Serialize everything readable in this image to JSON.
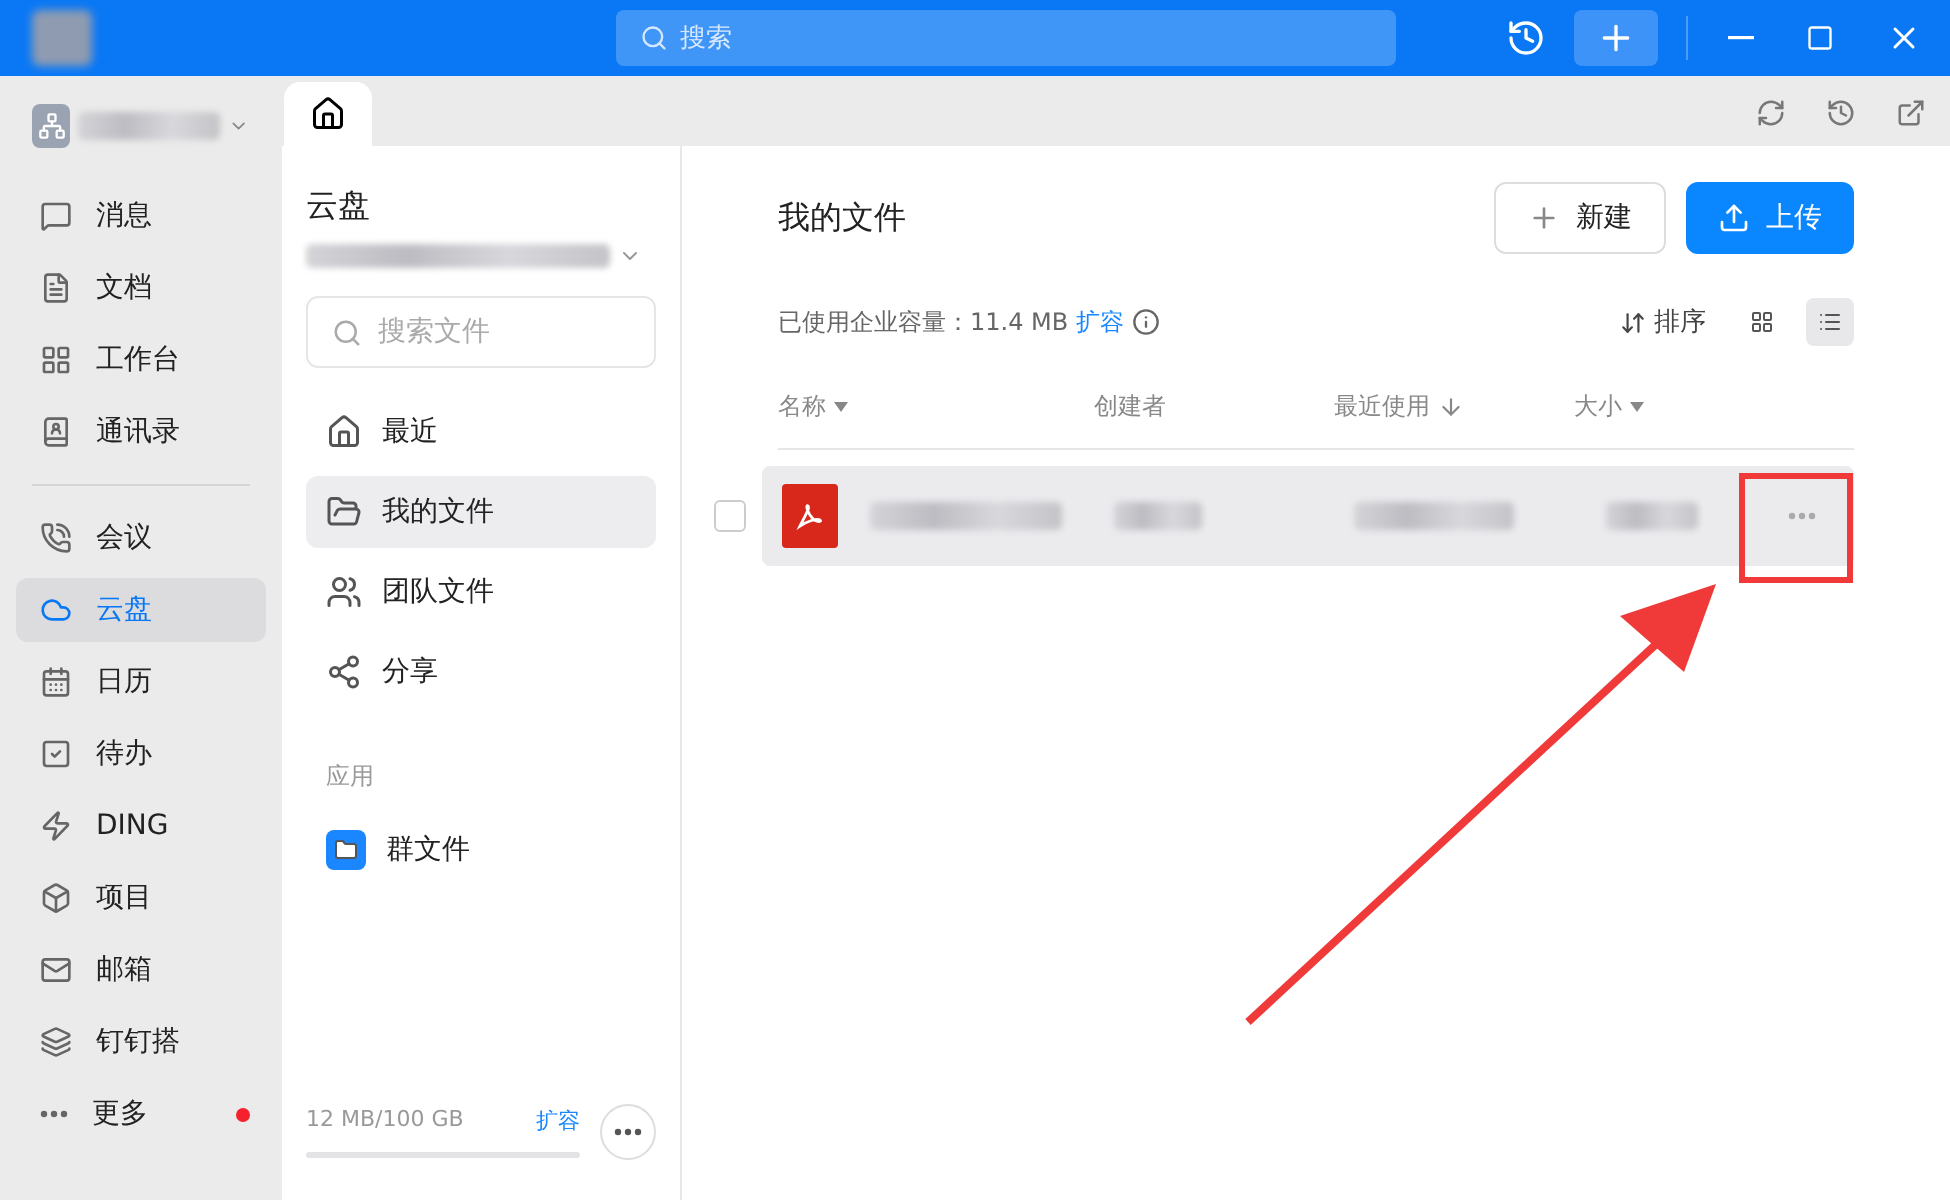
{
  "topbar": {
    "search_placeholder": "搜索"
  },
  "nav": {
    "items": [
      {
        "label": "消息",
        "selected": false,
        "badge": false
      },
      {
        "label": "文档",
        "selected": false,
        "badge": false
      },
      {
        "label": "工作台",
        "selected": false,
        "badge": false
      },
      {
        "label": "通讯录",
        "selected": false,
        "badge": false
      },
      {
        "label": "会议",
        "selected": false,
        "badge": false
      },
      {
        "label": "云盘",
        "selected": true,
        "badge": false
      },
      {
        "label": "日历",
        "selected": false,
        "badge": false
      },
      {
        "label": "待办",
        "selected": false,
        "badge": false
      },
      {
        "label": "DING",
        "selected": false,
        "badge": false
      },
      {
        "label": "项目",
        "selected": false,
        "badge": false
      },
      {
        "label": "邮箱",
        "selected": false,
        "badge": false
      },
      {
        "label": "钉钉搭",
        "selected": false,
        "badge": false
      },
      {
        "label": "更多",
        "selected": false,
        "badge": true
      }
    ]
  },
  "drive": {
    "title": "云盘",
    "search_placeholder": "搜索文件",
    "items": [
      {
        "label": "最近",
        "selected": false
      },
      {
        "label": "我的文件",
        "selected": true
      },
      {
        "label": "团队文件",
        "selected": false
      },
      {
        "label": "分享",
        "selected": false
      }
    ],
    "apps_heading": "应用",
    "apps": [
      {
        "label": "群文件"
      }
    ],
    "storage": {
      "text": "12 MB/100 GB",
      "link": "扩容"
    }
  },
  "main": {
    "title": "我的文件",
    "new_button": "新建",
    "upload_button": "上传",
    "usage_label": "已使用企业容量：11.4 MB",
    "usage_link": "扩容",
    "sort_label": "排序",
    "views": [
      {
        "kind": "grid",
        "selected": false
      },
      {
        "kind": "list",
        "selected": true
      }
    ],
    "columns": [
      {
        "label": "名称",
        "kind": "dropdown"
      },
      {
        "label": "创建者",
        "kind": "plain"
      },
      {
        "label": "最近使用",
        "kind": "sorted"
      },
      {
        "label": "大小",
        "kind": "dropdown"
      }
    ],
    "rows": [
      {
        "checked": false,
        "highlighted": true
      }
    ]
  }
}
